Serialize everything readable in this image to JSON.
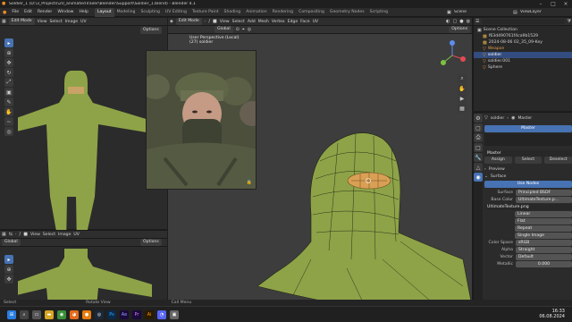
{
  "window": {
    "title": "Soldier_1 (D:\\3_Projects\\20_animatedTrailer\\Blender\\Support\\Soldier_1.blend) - Blender 4.1"
  },
  "menubar": {
    "menus": [
      "File",
      "Edit",
      "Render",
      "Window",
      "Help"
    ],
    "workspaces": [
      "Layout",
      "Modeling",
      "Sculpting",
      "UV Editing",
      "Texture Paint",
      "Shading",
      "Animation",
      "Rendering",
      "Compositing",
      "Geometry Nodes",
      "Scripting"
    ],
    "active_workspace": "Layout",
    "scene_label": "Scene",
    "view_layer_label": "ViewLayer"
  },
  "image_editor_top": {
    "mode": "Edit Mode",
    "menus": [
      "View",
      "Select",
      "Image",
      "UV"
    ],
    "options_label": "Options"
  },
  "image_editor_bottom": {
    "mode": "Global",
    "menus": [
      "View",
      "Select",
      "Image",
      "UV"
    ],
    "options_label": "Options"
  },
  "viewport": {
    "mode": "Edit Mode",
    "menus": [
      "View",
      "Select",
      "Add",
      "Mesh",
      "Vertex",
      "Edge",
      "Face",
      "UV"
    ],
    "overlay_line1": "User Perspective (Local)",
    "overlay_line2": "(27) soldier",
    "transform_orientation": "Global",
    "options_label": "Options",
    "colors": {
      "mesh": "#8ea348",
      "mesh_dark": "#6f8436",
      "selected": "#d9a055",
      "bg": "#3d3d3d"
    }
  },
  "outliner": {
    "search_placeholder": "",
    "items": [
      {
        "label": "Scene Collection",
        "indent": 0,
        "selected": false
      },
      {
        "label": "f63d490761f4ca9b1529",
        "indent": 1,
        "selected": false
      },
      {
        "label": "2024-08-06 02_35_09-Key",
        "indent": 1,
        "selected": false
      },
      {
        "label": "Weapon",
        "indent": 1,
        "selected": false
      },
      {
        "label": "soldier",
        "indent": 1,
        "selected": true
      },
      {
        "label": "soldier.001",
        "indent": 1,
        "selected": false
      },
      {
        "label": "Sphere",
        "indent": 1,
        "selected": false
      }
    ]
  },
  "properties": {
    "object_name": "soldier",
    "material_name": "Master",
    "material_slot": "Master",
    "assign_label": "Assign",
    "select_label": "Select",
    "deselect_label": "Deselect",
    "preview_label": "Preview",
    "surface_label": "Surface",
    "use_nodes_label": "Use Nodes",
    "surface_field_label": "Surface",
    "surface_value": "Principled BSDF",
    "base_color_label": "Base Color",
    "base_color_value": "UltimateTexture.p...",
    "image_name": "UltimateTexture.png",
    "interp": "Linear",
    "projection": "Flat",
    "extension": "Repeat",
    "source": "Single Image",
    "color_space_label": "Color Space",
    "color_space_value": "sRGB",
    "alpha_label": "Alpha",
    "alpha_value": "Straight",
    "vector_label": "Vector",
    "vector_value": "Default",
    "metallic_label": "Metallic",
    "metallic_value": "0.000"
  },
  "statusbar": {
    "items": [
      "Select",
      "Rotate View",
      "Call Menu"
    ]
  },
  "taskbar": {
    "time": "16:33",
    "date": "06.08.2024",
    "icons": [
      "windows-icon",
      "search-icon",
      "taskview-icon",
      "explorer-icon",
      "chrome-icon",
      "firefox-icon",
      "blender-icon",
      "steam-icon",
      "ps-icon",
      "ae-icon",
      "pr-icon",
      "ai-icon",
      "discord-icon",
      "app-icon"
    ]
  }
}
